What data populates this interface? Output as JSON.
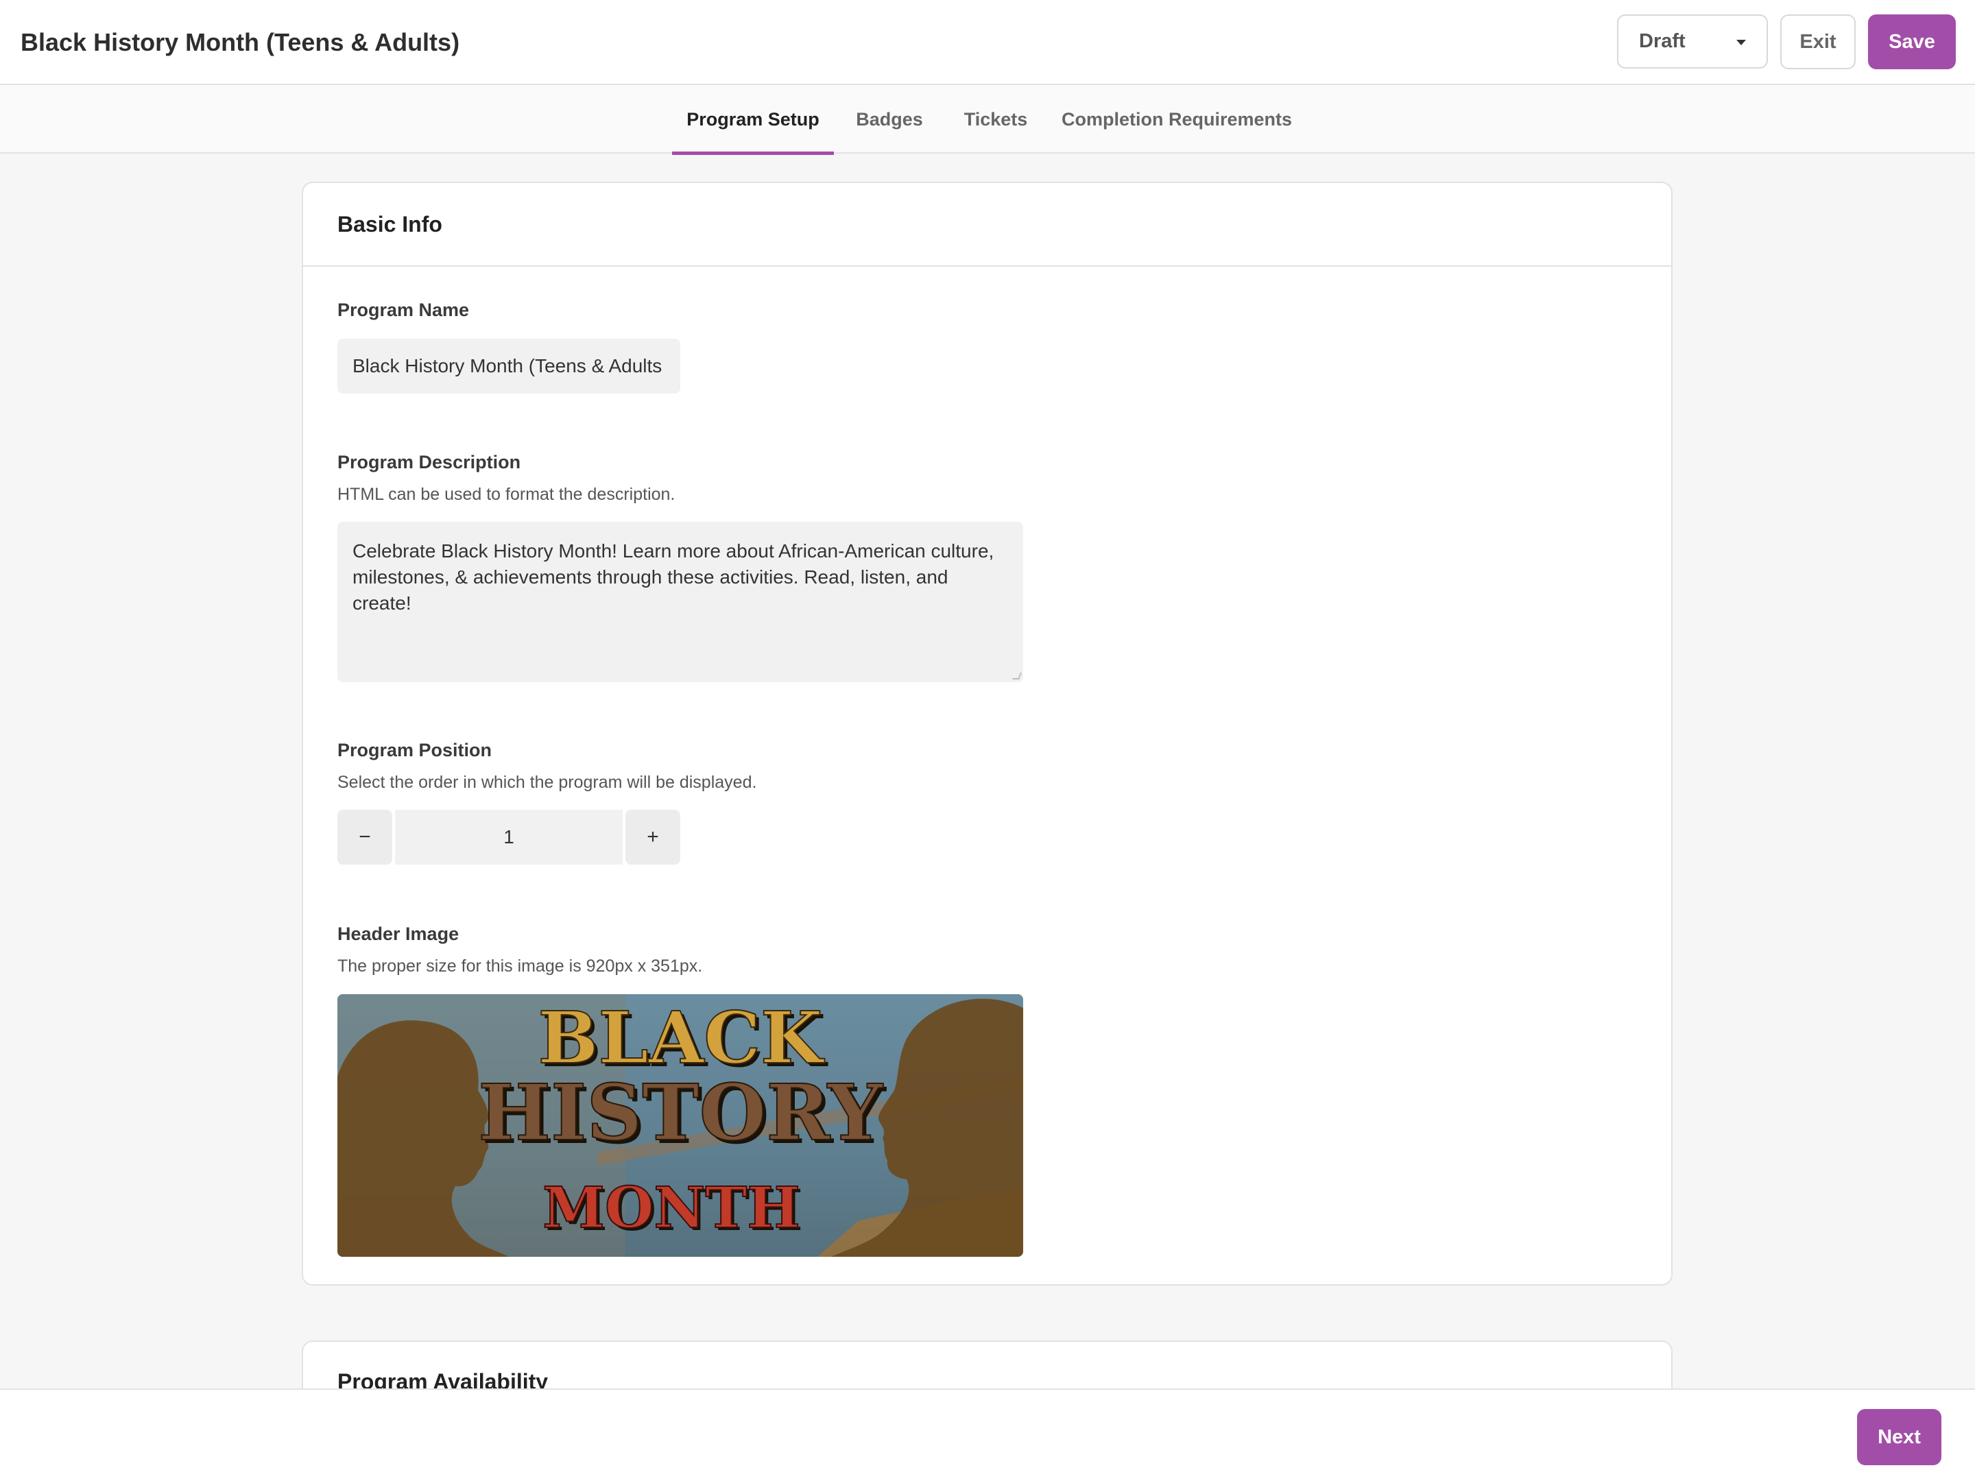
{
  "header": {
    "title": "Black History Month (Teens & Adults)",
    "status_value": "Draft",
    "exit_label": "Exit",
    "save_label": "Save"
  },
  "tabs": [
    {
      "label": "Program Setup",
      "active": true
    },
    {
      "label": "Badges",
      "active": false
    },
    {
      "label": "Tickets",
      "active": false
    },
    {
      "label": "Completion Requirements",
      "active": false
    }
  ],
  "basic_info": {
    "title": "Basic Info",
    "program_name": {
      "label": "Program Name",
      "value": "Black History Month (Teens & Adults"
    },
    "program_description": {
      "label": "Program Description",
      "help": "HTML can be used to format the description.",
      "value": "Celebrate Black History Month! Learn more about African-American culture, milestones, & achievements through these activities. Read, listen, and create!"
    },
    "program_position": {
      "label": "Program Position",
      "help": "Select the order in which the program will be displayed.",
      "value": "1",
      "decrement": "−",
      "increment": "+"
    },
    "header_image": {
      "label": "Header Image",
      "help": "The proper size for this image is 920px x 351px.",
      "line1": "BLACK",
      "line2": "HISTORY",
      "line3": "MONTH"
    }
  },
  "availability": {
    "title": "Program Availability"
  },
  "footer": {
    "next_label": "Next"
  },
  "colors": {
    "accent": "#a24ea8",
    "page_bg": "#f6f6f6",
    "input_bg": "#f1f1f1"
  }
}
